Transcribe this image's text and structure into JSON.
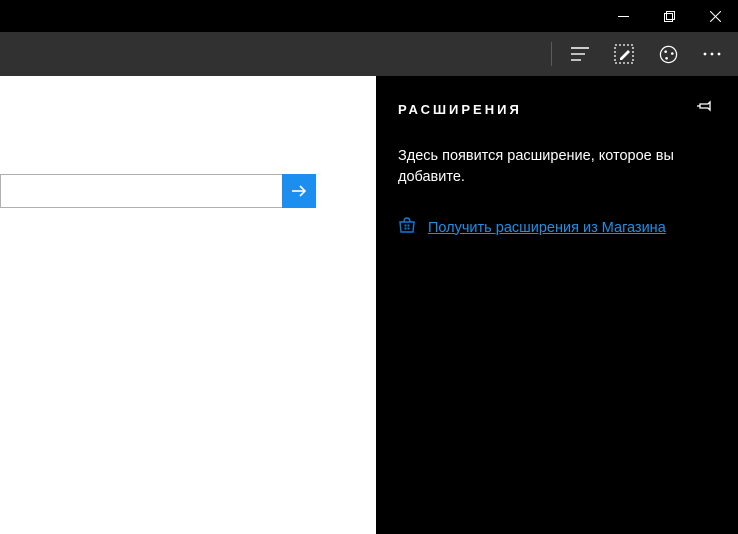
{
  "titlebar": {
    "minimize": "Свернуть",
    "maximize": "Развернуть",
    "close": "Закрыть"
  },
  "toolbar": {
    "hub": "Центр",
    "notes": "Заметки",
    "share": "Поделиться",
    "more": "Ещё"
  },
  "search": {
    "value": "",
    "placeholder": ""
  },
  "panel": {
    "title": "РАСШИРЕНИЯ",
    "description": "Здесь появится расширение, которое вы добавите.",
    "store_link": "Получить расширения из Магазина",
    "pin": "Закрепить"
  },
  "colors": {
    "accent": "#1c8ef0",
    "link": "#1e8fe6",
    "toolbar": "#313131"
  }
}
